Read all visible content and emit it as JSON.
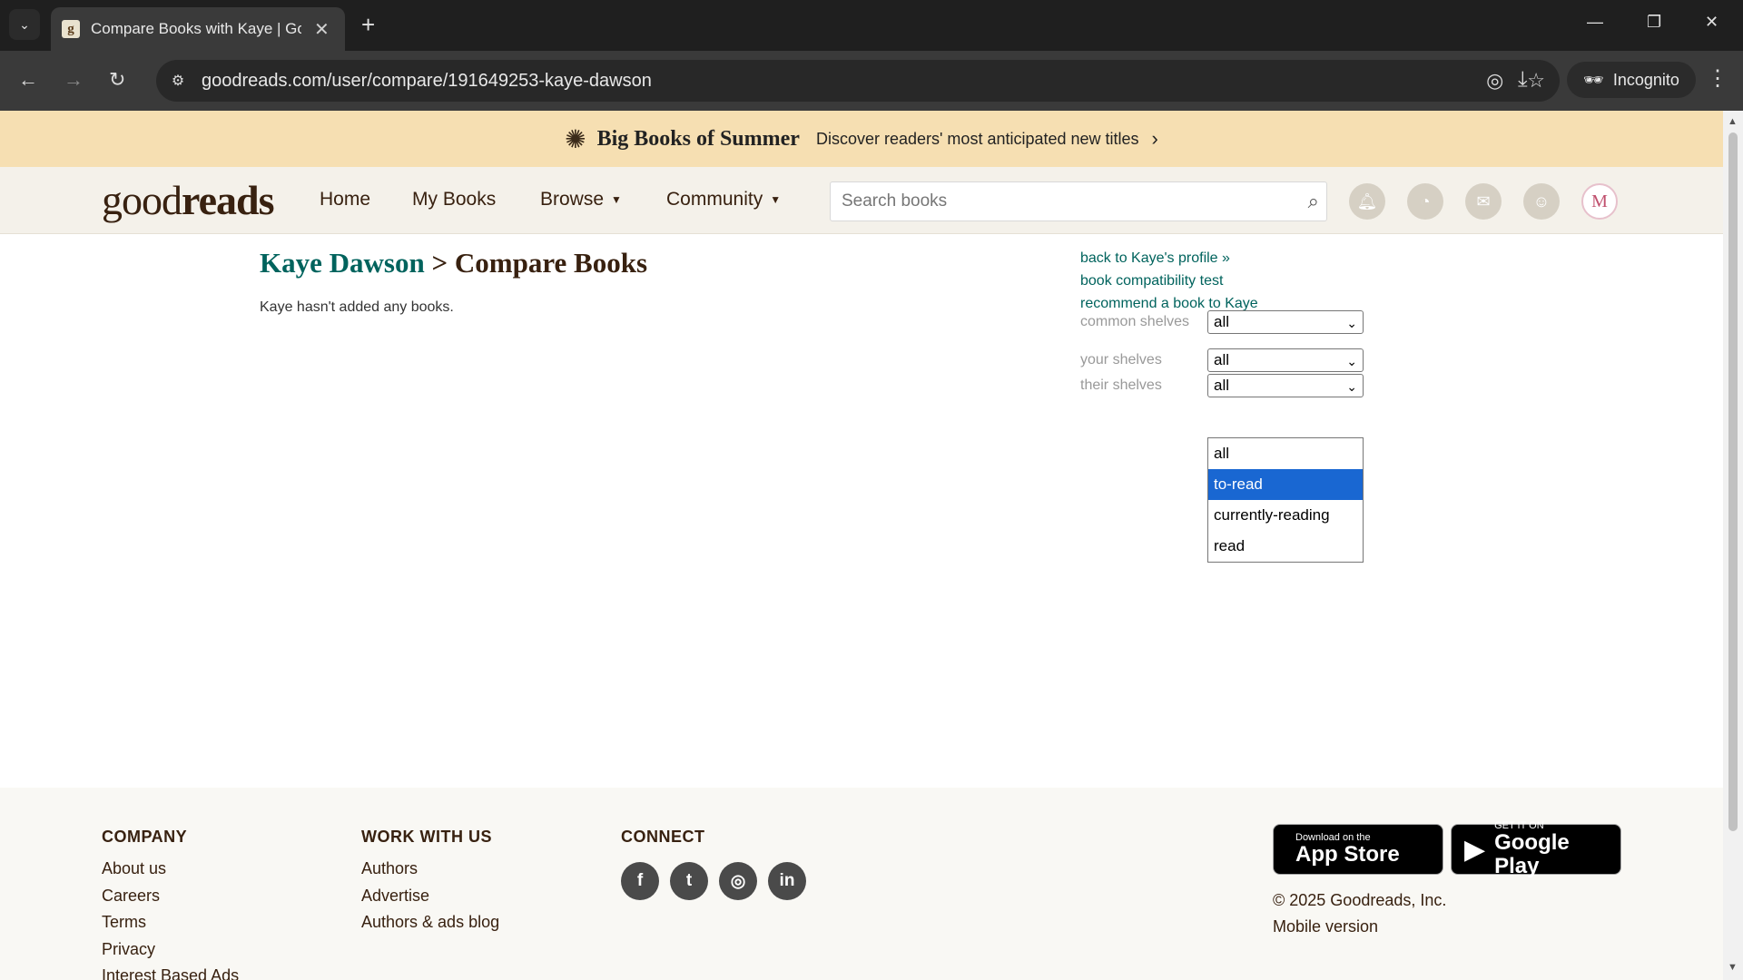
{
  "browser": {
    "tab_title": "Compare Books with Kaye | Goodreads",
    "favicon_letter": "g",
    "url": "goodreads.com/user/compare/191649253-kaye-dawson",
    "incognito_label": "Incognito"
  },
  "promo": {
    "title": "Big Books of Summer",
    "text": "Discover readers' most anticipated new titles"
  },
  "header": {
    "logo_light": "good",
    "logo_bold": "reads",
    "nav": {
      "home": "Home",
      "my_books": "My Books",
      "browse": "Browse",
      "community": "Community"
    },
    "search_placeholder": "Search books",
    "avatar_letter": "M"
  },
  "main": {
    "title_user": "Kaye Dawson",
    "title_sep": " > ",
    "title_rest": "Compare Books",
    "empty_message": "Kaye hasn't added any books.",
    "side_links": {
      "back_profile": "back to Kaye's profile »",
      "compat_test": "book compatibility test",
      "recommend": "recommend a book to Kaye"
    },
    "filters": {
      "common_label": "common shelves",
      "common_value": "all",
      "yours_label": "your shelves",
      "yours_value": "all",
      "theirs_label": "their shelves",
      "theirs_value": "all"
    },
    "dropdown_options": [
      "all",
      "to-read",
      "currently-reading",
      "read"
    ],
    "dropdown_highlighted": "to-read"
  },
  "footer": {
    "company": {
      "heading": "COMPANY",
      "links": [
        "About us",
        "Careers",
        "Terms",
        "Privacy",
        "Interest Based Ads"
      ]
    },
    "work": {
      "heading": "WORK WITH US",
      "links": [
        "Authors",
        "Advertise",
        "Authors & ads blog"
      ]
    },
    "connect": {
      "heading": "CONNECT"
    },
    "app_store": {
      "small": "Download on the",
      "big": "App Store"
    },
    "google_play": {
      "small": "GET IT ON",
      "big": "Google Play"
    },
    "copyright": "© 2025 Goodreads, Inc.",
    "mobile": "Mobile version"
  },
  "colors": {
    "brand_brown": "#382110",
    "link_teal": "#00635d",
    "promo_bg": "#f6dfb2",
    "header_bg": "#f4f1ea",
    "dropdown_highlight": "#1967d2"
  },
  "icons": {
    "promo": "book-sparkle-icon",
    "header": [
      "bell-icon",
      "chat-icon",
      "mail-icon",
      "friends-icon"
    ],
    "social": [
      "facebook-icon",
      "twitter-icon",
      "instagram-icon",
      "linkedin-icon"
    ]
  }
}
